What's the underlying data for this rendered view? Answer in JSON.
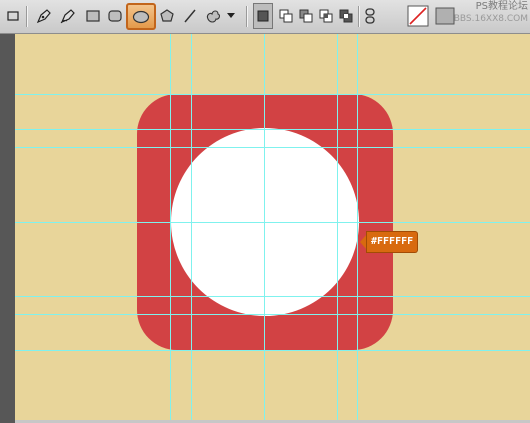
{
  "watermark": {
    "line1": "PS教程论坛",
    "line2": "BBS.16XX8.COM"
  },
  "color_tag": {
    "label": "#FFFFFF"
  },
  "colors": {
    "document_bg": "#e8d59a",
    "icon_red": "#d24244",
    "circle_fill": "#ffffff",
    "guide_line": "#7ff2ee",
    "tag_orange": "#d86a0f"
  },
  "tools": [
    "rectangle-select-icon",
    "pen-icon",
    "freeform-pen-icon",
    "rectangle-shape-icon",
    "rounded-rectangle-icon",
    "ellipse-icon",
    "polygon-icon",
    "line-icon",
    "custom-shape-icon",
    "dropdown-arrow-icon",
    "new-layer-icon",
    "add-shape-icon",
    "subtract-shape-icon",
    "intersect-shape-icon",
    "exclude-shape-icon",
    "link-icon",
    "style-swatch-icon",
    "color-swatch-icon"
  ]
}
